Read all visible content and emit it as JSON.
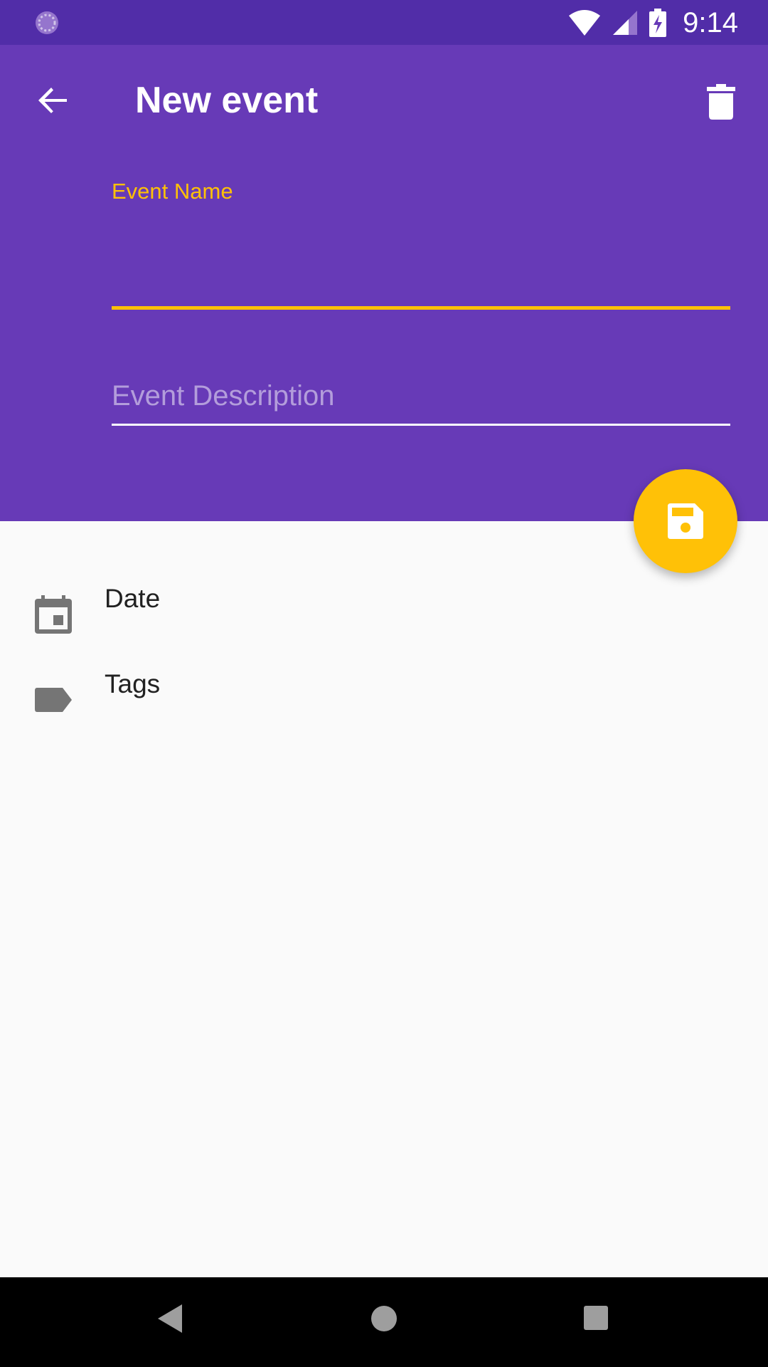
{
  "status_bar": {
    "time": "9:14",
    "icons": [
      "sync-icon",
      "wifi-icon",
      "signal-icon",
      "battery-charging-icon"
    ]
  },
  "header": {
    "title": "New event",
    "back_icon": "arrow-back-icon",
    "delete_icon": "trash-icon"
  },
  "form": {
    "event_name": {
      "label": "Event Name",
      "value": ""
    },
    "event_description": {
      "placeholder": "Event Description",
      "value": ""
    }
  },
  "fab": {
    "icon": "save-icon"
  },
  "list": {
    "items": [
      {
        "label": "Date",
        "icon": "calendar-icon"
      },
      {
        "label": "Tags",
        "icon": "label-icon"
      }
    ]
  },
  "nav_bar": {
    "icons": [
      "nav-back-icon",
      "nav-home-icon",
      "nav-recents-icon"
    ]
  },
  "colors": {
    "primary": "#673ab7",
    "primary_dark": "#512da8",
    "accent": "#ffc107",
    "background": "#fafafa",
    "icon_gray": "#757575"
  }
}
